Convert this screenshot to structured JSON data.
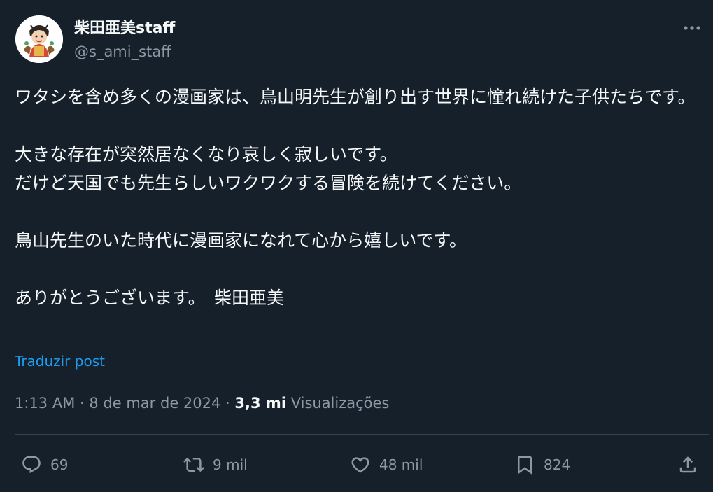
{
  "author": {
    "name": "柴田亜美staff",
    "handle": "@s_ami_staff"
  },
  "icons": {
    "more": "more-horizontal-icon",
    "reply": "reply-bubble-icon",
    "retweet": "retweet-icon",
    "like": "heart-icon",
    "bookmark": "bookmark-icon",
    "share": "share-upload-icon"
  },
  "tweet": {
    "paragraphs": [
      "ワタシを含め多くの漫画家は、鳥山明先生が創り出す世界に憧れ続けた子供たちです。",
      "大きな存在が突然居なくなり哀しく寂しいです。\nだけど天国でも先生らしいワクワクする冒険を続けてください。",
      "鳥山先生のいた時代に漫画家になれて心から嬉しいです。",
      "ありがとうございます。　柴田亜美"
    ],
    "translate_label": "Traduzir post"
  },
  "meta": {
    "time": "1:13 AM",
    "separator": "·",
    "date": "8 de mar de 2024",
    "views_count": "3,3 mi",
    "views_label": "Visualizações"
  },
  "actions": {
    "replies": "69",
    "retweets": "9 mil",
    "likes": "48 mil",
    "bookmarks": "824"
  },
  "colors": {
    "background": "#15202b",
    "text": "#f7f9f9",
    "secondary": "#8b98a5",
    "link": "#1d9bf0",
    "divider": "#38444d"
  }
}
